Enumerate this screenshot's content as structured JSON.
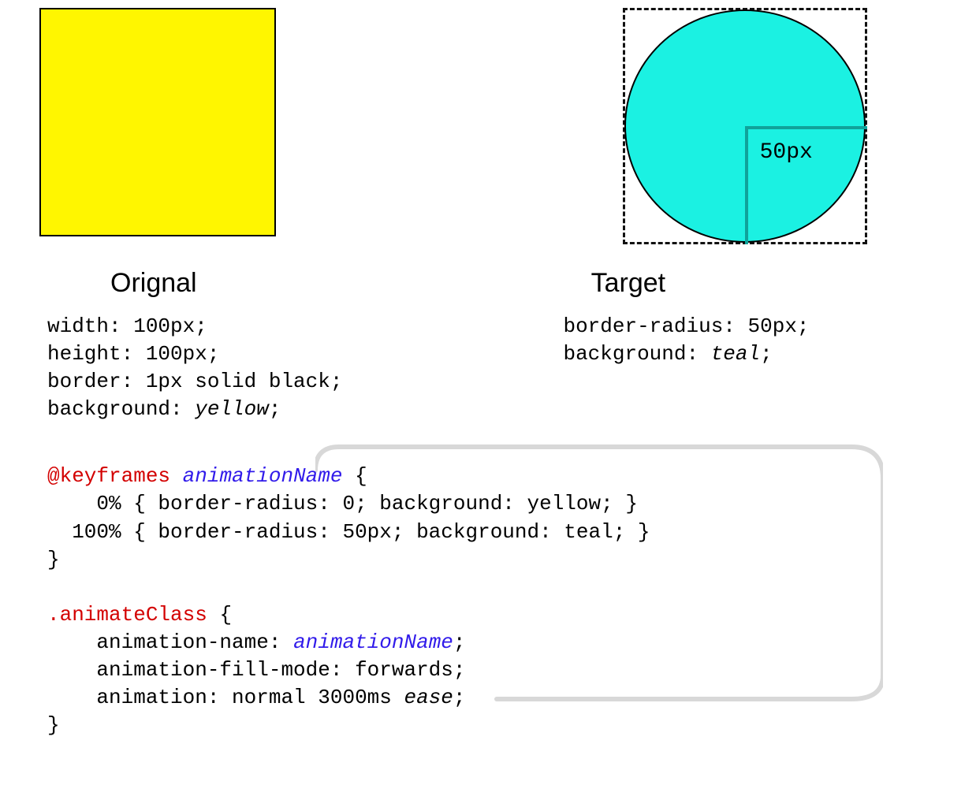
{
  "diagram": {
    "original_label": "Orignal",
    "target_label": "Target",
    "radius_label": "50px",
    "original_css": {
      "width": "width: 100px;",
      "height": "height: 100px;",
      "border": "border: 1px solid black;",
      "background_prefix": "background: ",
      "background_value": "yellow",
      "background_suffix": ";"
    },
    "target_css": {
      "border_radius": "border-radius: 50px;",
      "background_prefix": "background: ",
      "background_value": "teal",
      "background_suffix": ";"
    },
    "code": {
      "keyframes_keyword": "@keyframes",
      "animation_name": "animationName",
      "open_brace": " {",
      "kf_line1": "    0% { border-radius: 0; background: yellow; }",
      "kf_line2": "  100% { border-radius: 50px; background: teal; }",
      "close_brace": "}",
      "class_name": ".animateClass",
      "anim_name_prop_prefix": "    animation-name: ",
      "anim_name_prop_value": "animationName",
      "anim_name_prop_suffix": ";",
      "anim_fill": "    animation-fill-mode: forwards;",
      "anim_prefix": "    animation: normal 3000ms ",
      "anim_value": "ease",
      "anim_suffix": ";"
    }
  }
}
